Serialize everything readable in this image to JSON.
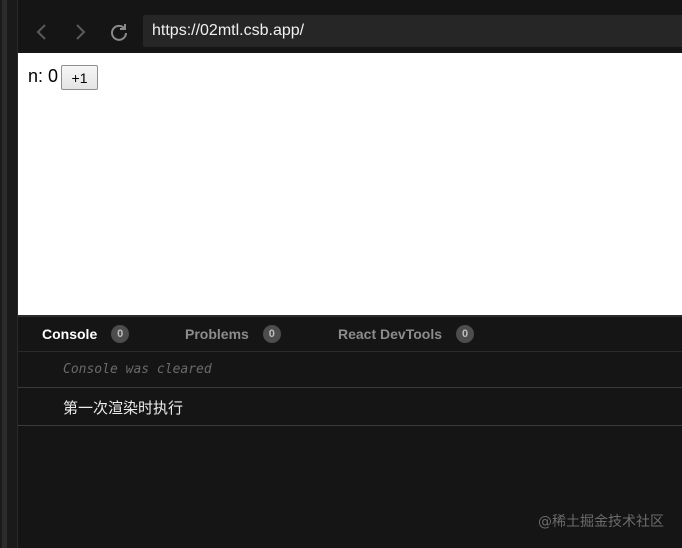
{
  "browser": {
    "url": "https://02mtl.csb.app/",
    "back_icon": "chevron-left-icon",
    "forward_icon": "chevron-right-icon",
    "refresh_icon": "refresh-icon"
  },
  "preview": {
    "counter_text": "n: 0",
    "increment_label": "+1"
  },
  "devtools": {
    "tabs": [
      {
        "label": "Console",
        "count": "0",
        "active": true
      },
      {
        "label": "Problems",
        "count": "0",
        "active": false
      },
      {
        "label": "React DevTools",
        "count": "0",
        "active": false
      }
    ],
    "logs": [
      {
        "text": "Console was cleared",
        "kind": "system"
      },
      {
        "text": "第一次渲染时执行",
        "kind": "log"
      }
    ]
  },
  "watermark": "@稀土掘金技术社区",
  "colors": {
    "background": "#151515",
    "url_bar": "#262626",
    "preview_bg": "#ffffff",
    "badge_bg": "#4d4d4d"
  }
}
